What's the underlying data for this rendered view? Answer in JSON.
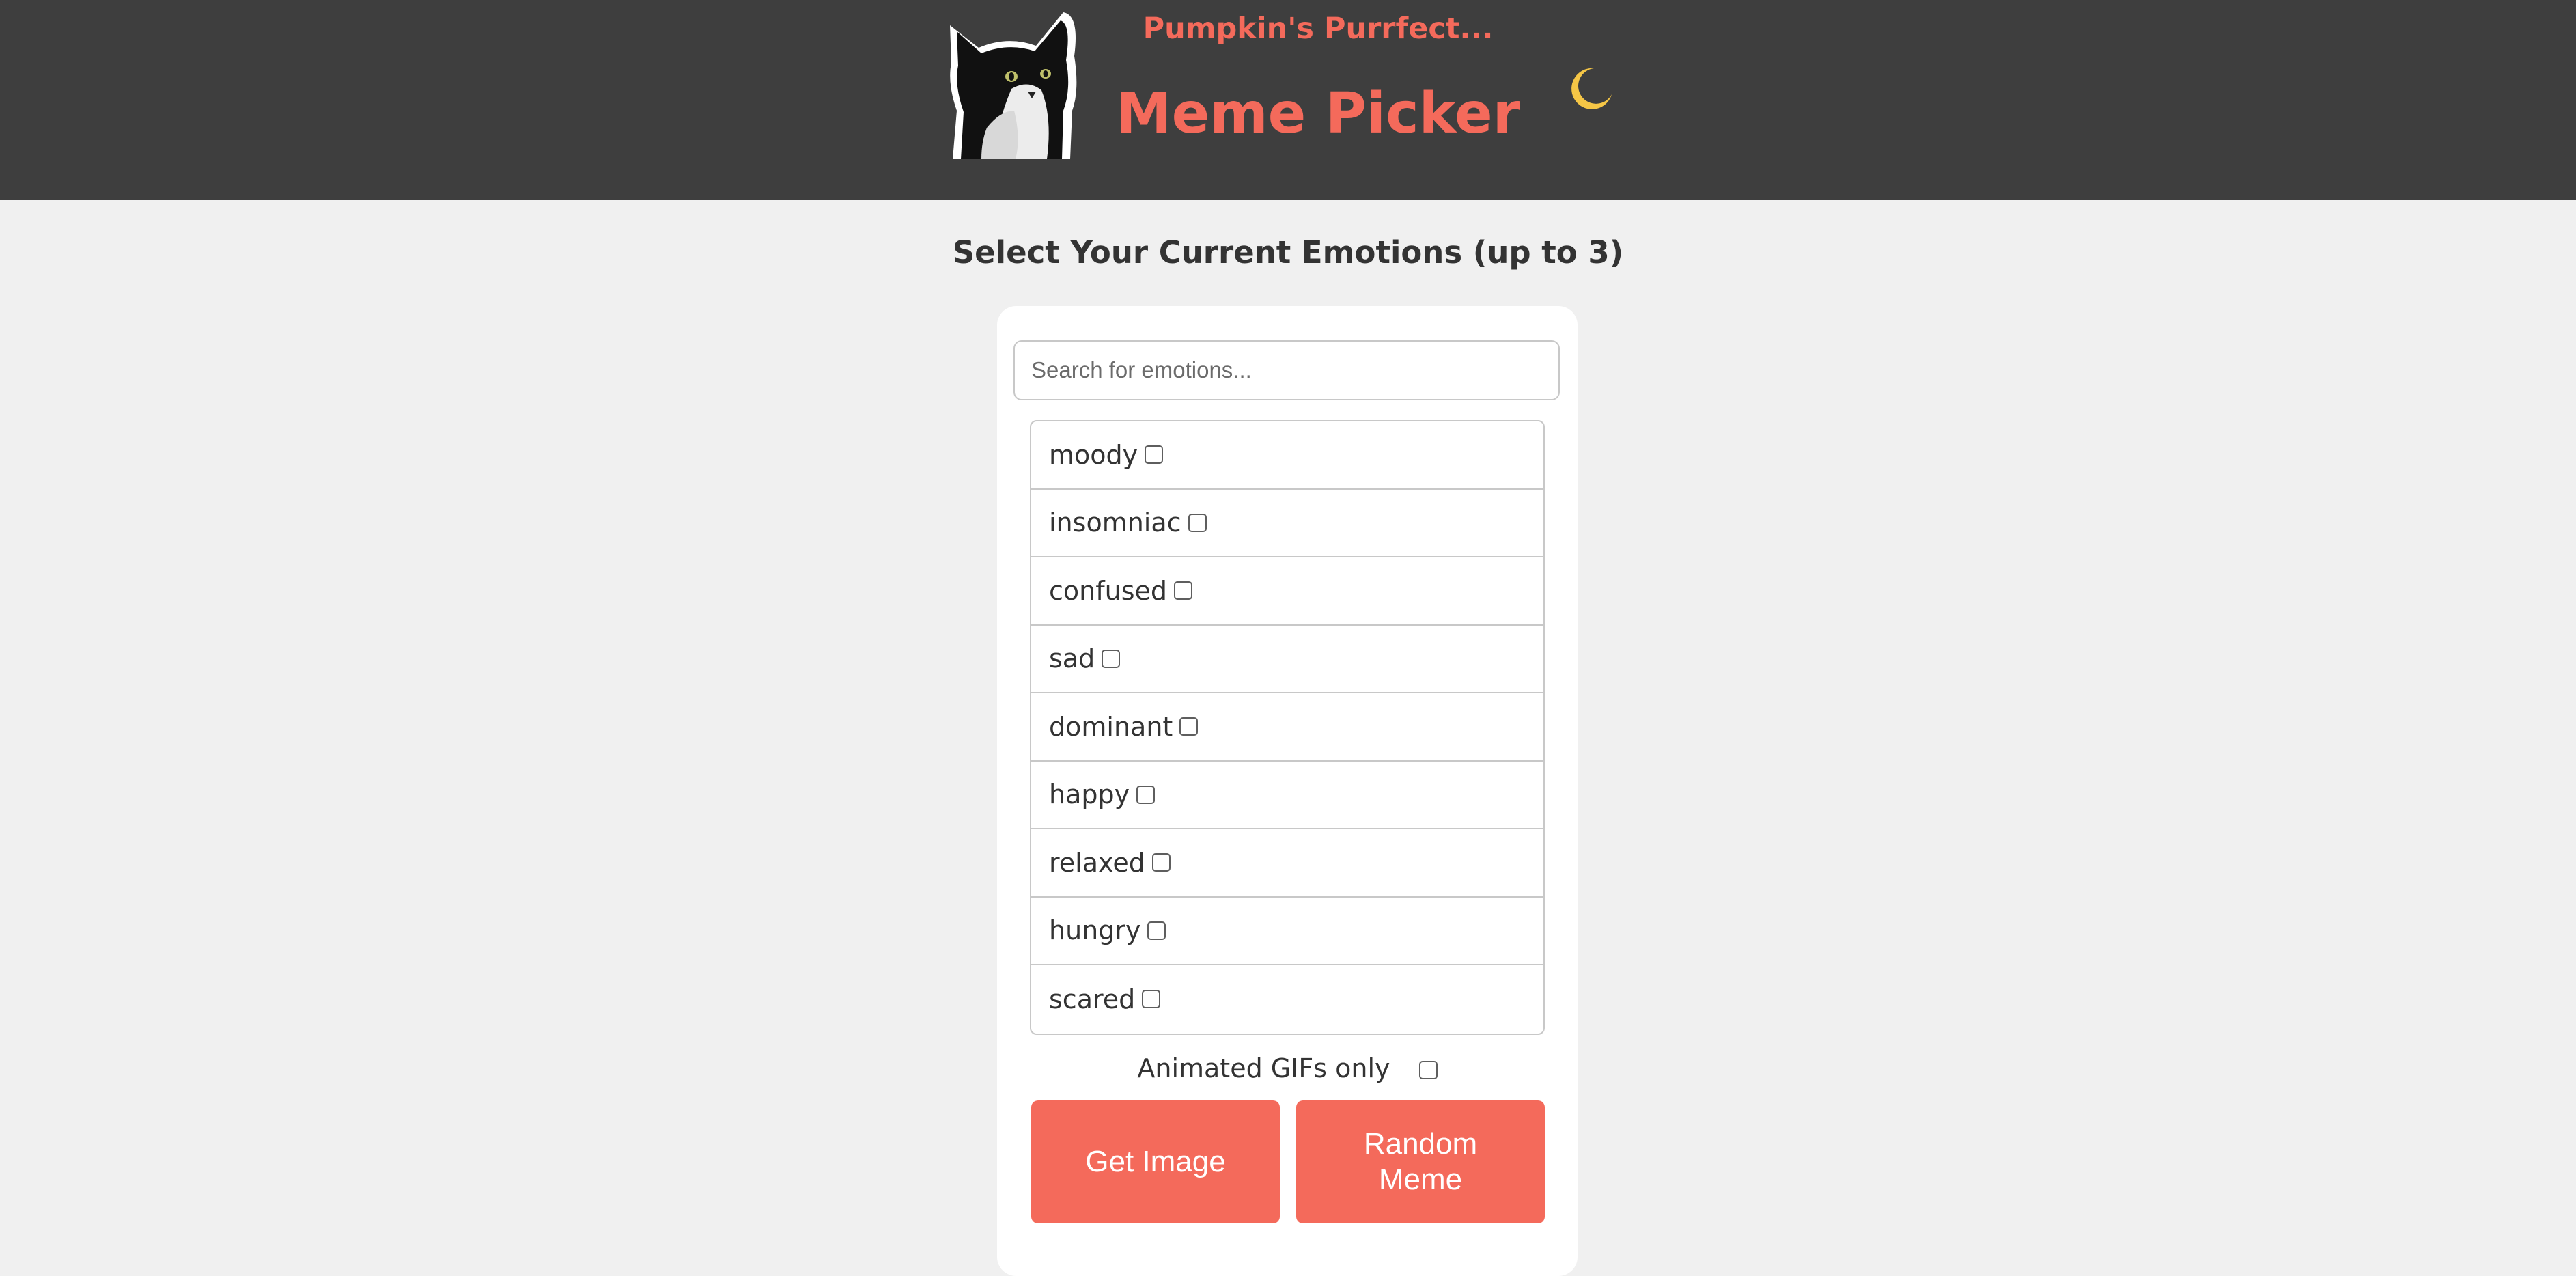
{
  "header": {
    "subtitle": "Pumpkin's Purrfect...",
    "title": "Meme Picker",
    "theme_icon": "moon-icon"
  },
  "page_heading": "Select Your Current Emotions (up to 3)",
  "search": {
    "placeholder": "Search for emotions...",
    "value": ""
  },
  "emotions": [
    {
      "label": "moody",
      "checked": false
    },
    {
      "label": "insomniac",
      "checked": false
    },
    {
      "label": "confused",
      "checked": false
    },
    {
      "label": "sad",
      "checked": false
    },
    {
      "label": "dominant",
      "checked": false
    },
    {
      "label": "happy",
      "checked": false
    },
    {
      "label": "relaxed",
      "checked": false
    },
    {
      "label": "hungry",
      "checked": false
    },
    {
      "label": "scared",
      "checked": false
    }
  ],
  "gif_option": {
    "label": "Animated GIFs only",
    "checked": false
  },
  "buttons": {
    "get_image": "Get Image",
    "random_meme": "Random Meme"
  },
  "colors": {
    "header_bg": "#3e3e3e",
    "accent": "#f46a5b",
    "page_bg": "#f0f0f0",
    "moon": "#f5c646"
  }
}
